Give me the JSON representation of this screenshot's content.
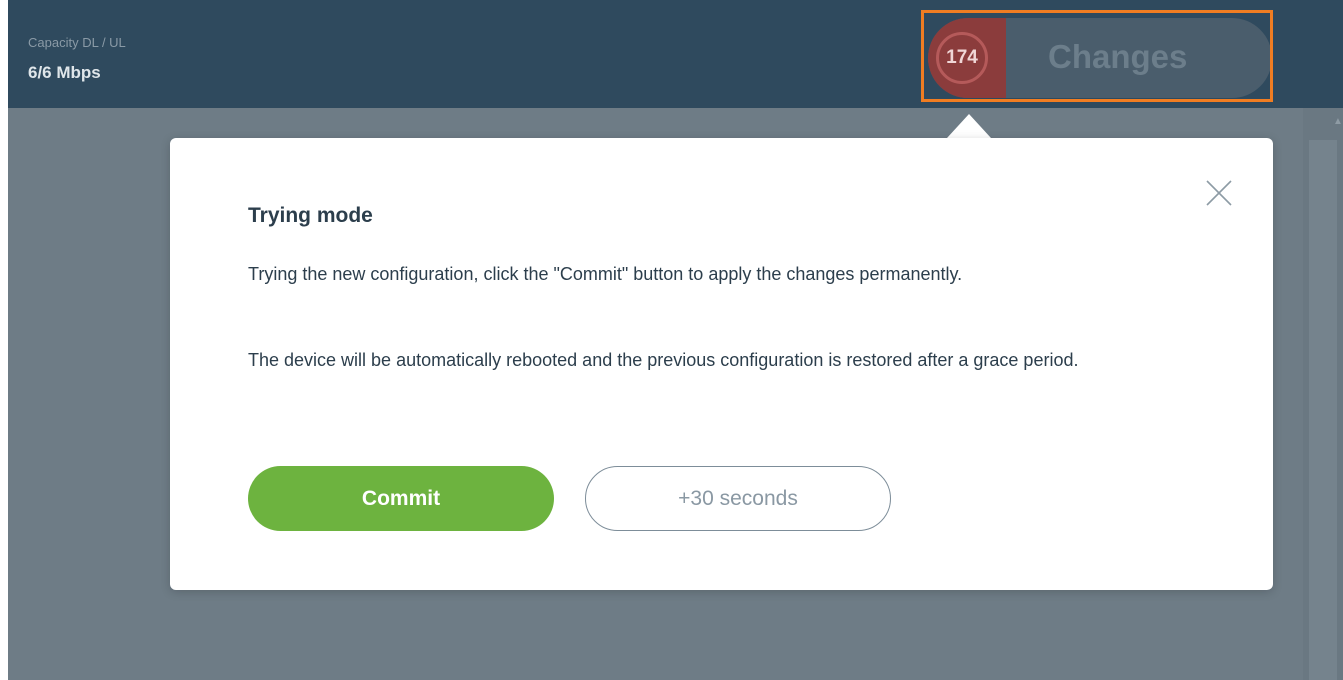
{
  "header": {
    "capacity_label": "Capacity DL / UL",
    "capacity_value": "6/6 Mbps"
  },
  "changes": {
    "count": "174",
    "label": "Changes"
  },
  "dialog": {
    "title": "Trying mode",
    "paragraph1": "Trying the new configuration, click the \"Commit\" button to apply the changes permanently.",
    "paragraph2": "The device will be automatically rebooted and the previous configuration is restored after a grace period.",
    "commit_label": "Commit",
    "extend_label": "+30 seconds",
    "close_icon": "close-icon"
  },
  "colors": {
    "header_bg": "#2f4a5e",
    "overlay_bg": "#6e7c86",
    "commit_green": "#6db33f",
    "highlight_orange": "#f07d22",
    "counter_red": "#8b3c3c"
  }
}
